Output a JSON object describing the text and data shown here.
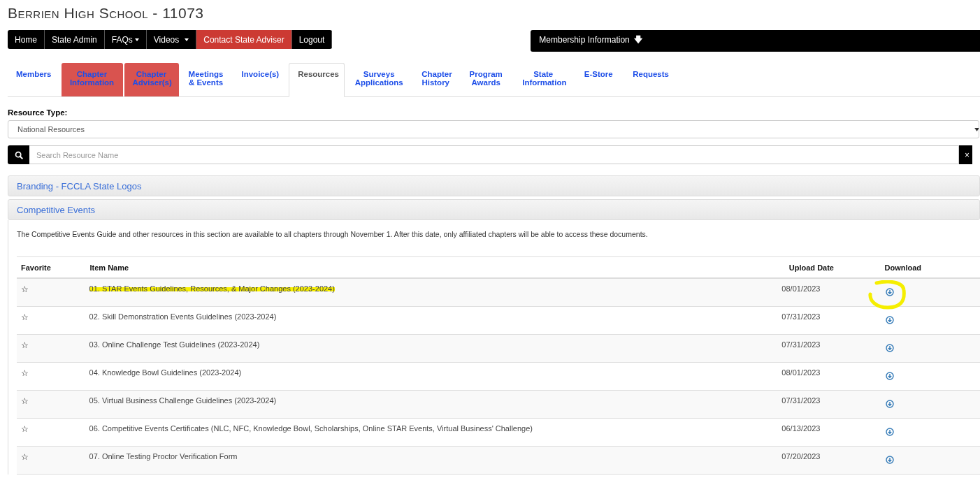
{
  "page_title": "Berrien High School - 11073",
  "nav": [
    {
      "label": "Home",
      "dropdown": false,
      "flagged": false
    },
    {
      "label": "State Admin",
      "dropdown": false,
      "flagged": false
    },
    {
      "label": "FAQs",
      "dropdown": true,
      "flagged": false
    },
    {
      "label": "Videos",
      "dropdown": true,
      "flagged": false
    },
    {
      "label": "Contact State Adviser",
      "dropdown": false,
      "flagged": true
    },
    {
      "label": "Logout",
      "dropdown": false,
      "flagged": false
    }
  ],
  "membership_bar": {
    "label": "Membership Information",
    "arrow": "🡇"
  },
  "tabs": [
    {
      "label": "Members",
      "selected": false,
      "flagged": false
    },
    {
      "label": "Chapter Information",
      "selected": false,
      "flagged": true
    },
    {
      "label": "Chapter Adviser(s)",
      "selected": false,
      "flagged": true
    },
    {
      "label": "Meetings & Events",
      "selected": false,
      "flagged": false
    },
    {
      "label": "Invoice(s)",
      "selected": false,
      "flagged": false
    },
    {
      "label": "Resources",
      "selected": true,
      "flagged": false
    },
    {
      "label": "Surveys Applications",
      "selected": false,
      "flagged": false
    },
    {
      "label": "Chapter History",
      "selected": false,
      "flagged": false
    },
    {
      "label": "Program Awards",
      "selected": false,
      "flagged": false
    },
    {
      "label": "State Information",
      "selected": false,
      "flagged": false
    },
    {
      "label": "E-Store",
      "selected": false,
      "flagged": false
    },
    {
      "label": "Requests",
      "selected": false,
      "flagged": false
    }
  ],
  "resource_type": {
    "label": "Resource Type:",
    "value": "National Resources"
  },
  "search": {
    "placeholder": "Search Resource Name",
    "clear": "×"
  },
  "panels": [
    {
      "title": "Branding - FCCLA State Logos"
    },
    {
      "title": "Competitive Events",
      "notice": "The Competitive Events Guide and other resources in this section are available to all chapters through November 1. After this date, only affiliated chapters will be able to access these documents.",
      "table": {
        "columns": [
          "Favorite",
          "Item Name",
          "Upload Date",
          "Download"
        ],
        "rows": [
          {
            "star": "☆",
            "name": "01. STAR Events Guidelines, Resources, & Major Changes (2023-2024)",
            "date": "08/01/2023",
            "highlighted": true
          },
          {
            "star": "☆",
            "name": "02. Skill Demonstration Events Guidelines (2023-2024)",
            "date": "07/31/2023",
            "highlighted": false
          },
          {
            "star": "☆",
            "name": "03. Online Challenge Test Guidelines (2023-2024)",
            "date": "07/31/2023",
            "highlighted": false
          },
          {
            "star": "☆",
            "name": "04. Knowledge Bowl Guidelines (2023-2024)",
            "date": "08/01/2023",
            "highlighted": false
          },
          {
            "star": "☆",
            "name": "05. Virtual Business Challenge Guidelines (2023-2024)",
            "date": "07/31/2023",
            "highlighted": false
          },
          {
            "star": "☆",
            "name": "06. Competitive Events Certificates (NLC, NFC, Knowledge Bowl, Scholarships, Online STAR Events, Virtual Business' Challenge)",
            "date": "06/13/2023",
            "highlighted": false
          },
          {
            "star": "☆",
            "name": "07. Online Testing Proctor Verification Form",
            "date": "07/20/2023",
            "highlighted": false
          }
        ]
      }
    }
  ]
}
